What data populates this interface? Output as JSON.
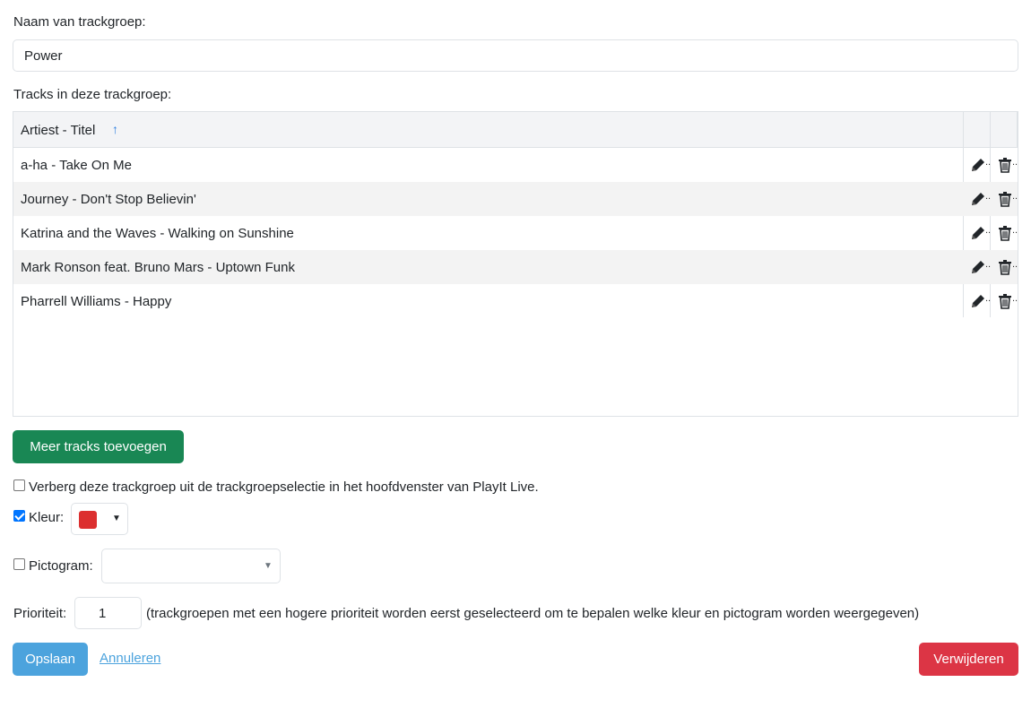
{
  "form": {
    "name_label": "Naam van trackgroep:",
    "name_value": "Power",
    "tracks_label": "Tracks in deze trackgroep:"
  },
  "grid": {
    "column_header": "Artiest - Titel",
    "sort_icon": "↑",
    "rows": [
      {
        "label": "a-ha - Take On Me"
      },
      {
        "label": "Journey - Don't Stop Believin'"
      },
      {
        "label": "Katrina and the Waves - Walking on Sunshine"
      },
      {
        "label": "Mark Ronson feat. Bruno Mars - Uptown Funk"
      },
      {
        "label": "Pharrell Williams - Happy"
      }
    ],
    "row_edit_icon": "pencil-icon",
    "row_delete_icon": "trash-icon",
    "truncation": ".."
  },
  "add_button_label": "Meer tracks toevoegen",
  "options": {
    "hide_label": "Verberg deze trackgroep uit de trackgroepselectie in het hoofdvenster van PlayIt Live.",
    "hide_checked": false,
    "color_label": "Kleur:",
    "color_checked": true,
    "color_value": "#dc2f2f",
    "pictogram_label": "Pictogram:",
    "pictogram_checked": false,
    "pictogram_value": ""
  },
  "priority": {
    "label": "Prioriteit:",
    "value": "1",
    "hint": "(trackgroepen met een hogere prioriteit worden eerst geselecteerd om te bepalen welke kleur en pictogram worden weergegeven)"
  },
  "actions": {
    "save_label": "Opslaan",
    "cancel_label": "Annuleren",
    "delete_label": "Verwijderen"
  },
  "colors": {
    "primary_green": "#198754",
    "save_blue": "#4ca3dd",
    "delete_red": "#dc3545",
    "sort_blue": "#2f7fe0"
  }
}
